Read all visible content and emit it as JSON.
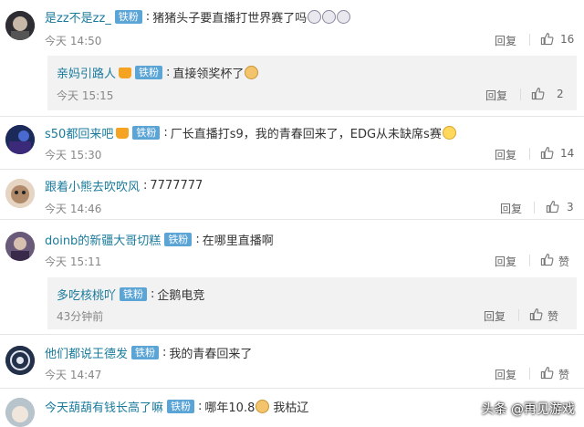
{
  "common": {
    "badge_label": "铁粉",
    "reply_label": "回复"
  },
  "comments": [
    {
      "user": "是zz不是zz_",
      "text": "猪猪头子要直播打世界赛了吗",
      "time": "今天 14:50",
      "likes": "16"
    },
    {
      "user": "亲妈引路人",
      "text": "直接领奖杯了",
      "time": "今天 15:15",
      "likes": "2"
    },
    {
      "user": "s50都回来吧",
      "text": "厂长直播打s9，我的青春回来了，EDG从未缺席s赛",
      "time": "今天 15:30",
      "likes": "14"
    },
    {
      "user": "跟着小熊去吹吹风",
      "text": "7777777",
      "time": "今天 14:46",
      "likes": "3"
    },
    {
      "user": "doinb的新疆大哥切糕",
      "text": "在哪里直播啊",
      "time": "今天 15:11",
      "likes": "赞"
    },
    {
      "user": "多吃核桃吖",
      "text": "企鹅电竞",
      "time": "43分钟前",
      "likes": "赞"
    },
    {
      "user": "他们都说王德发",
      "text": "我的青春回来了",
      "time": "今天 14:47",
      "likes": "赞"
    },
    {
      "user": "今天葫葫有钱长高了嘛",
      "text": "哪年10.8",
      "text2": "我枯辽",
      "time": "",
      "likes": ""
    }
  ],
  "watermark": "头条 @再见游戏",
  "icons": [
    "thumbs-up-icon",
    "crown-icon",
    "dog-emoji-icon",
    "cry-emoji-icon",
    "tear-emoji-icon"
  ],
  "colors": {
    "username": "#1a7b9c",
    "badge": "#5ba4d6",
    "reply_bg": "#f2f2f2"
  }
}
